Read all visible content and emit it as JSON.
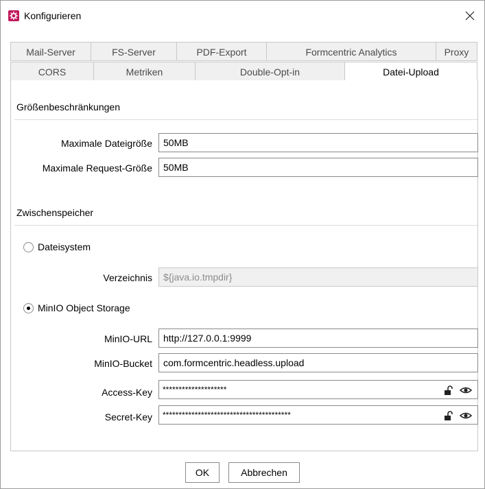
{
  "window": {
    "title": "Konfigurieren",
    "icon": "gear-icon",
    "accent": "#c2185b"
  },
  "tabs": {
    "row1": [
      "Mail-Server",
      "FS-Server",
      "PDF-Export",
      "Formcentric Analytics",
      "Proxy"
    ],
    "row2": [
      "CORS",
      "Metriken",
      "Double-Opt-in",
      "Datei-Upload"
    ],
    "active": "Datei-Upload"
  },
  "sizes": {
    "heading": "Größenbeschränkungen",
    "max_file_label": "Maximale Dateigröße",
    "max_file_value": "50MB",
    "max_request_label": "Maximale Request-Größe",
    "max_request_value": "50MB"
  },
  "cache": {
    "heading": "Zwischenspeicher",
    "filesystem_label": "Dateisystem",
    "directory_label": "Verzeichnis",
    "directory_value": "${java.io.tmpdir}",
    "minio_label": "MinIO Object Storage",
    "minio_url_label": "MinIO-URL",
    "minio_url_value": "http://127.0.0.1:9999",
    "minio_bucket_label": "MinIO-Bucket",
    "minio_bucket_value": "com.formcentric.headless.upload",
    "access_key_label": "Access-Key",
    "access_key_value": "********************",
    "secret_key_label": "Secret-Key",
    "secret_key_value": "****************************************",
    "selected": "MinIO Object Storage"
  },
  "buttons": {
    "ok": "OK",
    "cancel": "Abbrechen"
  }
}
